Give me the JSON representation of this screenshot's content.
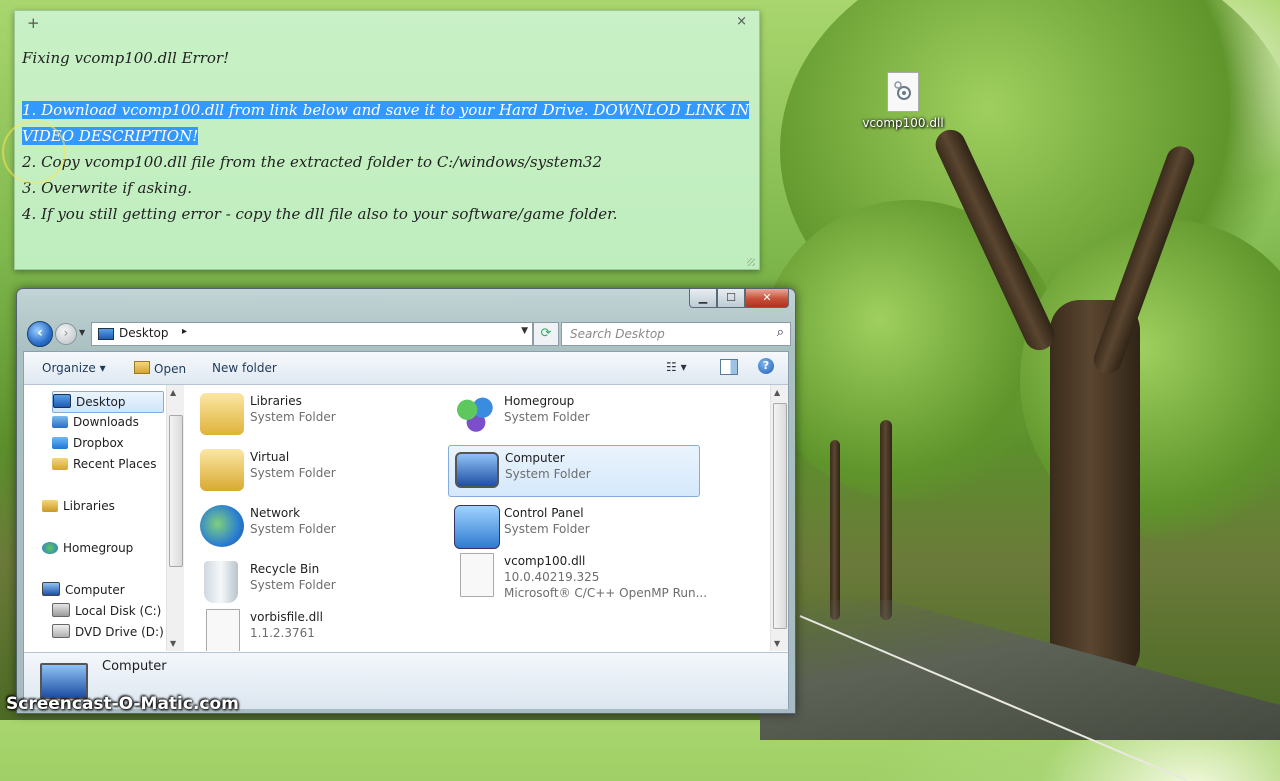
{
  "sticky_note": {
    "title": "Fixing vcomp100.dll Error!",
    "step1_selected": "1. Download vcomp100.dll from link below and save it to your Hard Drive. DOWNLOD LINK IN VIDEO DESCRIPTION!",
    "step2": "2. Copy vcomp100.dll file from the extracted folder to C:/windows/system32",
    "step3": "3. Overwrite if asking.",
    "step4": "4. If you still getting error - copy the dll file also to your software/game folder.",
    "new_note_glyph": "+",
    "close_glyph": "×"
  },
  "desktop": {
    "icon_label": "vcomp100.dll"
  },
  "explorer": {
    "address": {
      "location": "Desktop",
      "separator": "▸"
    },
    "search": {
      "placeholder": "Search Desktop"
    },
    "toolbar": {
      "organize": "Organize ▾",
      "open": "Open",
      "new_folder": "New folder"
    },
    "nav": [
      {
        "label": "Desktop",
        "icon": "desktop-icon",
        "selected": true
      },
      {
        "label": "Downloads",
        "icon": "downloads-icon"
      },
      {
        "label": "Dropbox",
        "icon": "dropbox-icon"
      },
      {
        "label": "Recent Places",
        "icon": "recent-places-icon"
      },
      {
        "label": "Libraries",
        "icon": "libraries-icon"
      },
      {
        "label": "Homegroup",
        "icon": "homegroup-icon"
      },
      {
        "label": "Computer",
        "icon": "computer-icon"
      },
      {
        "label": "Local Disk (C:)",
        "icon": "local-disk-icon"
      },
      {
        "label": "DVD Drive (D:) GF",
        "icon": "dvd-drive-icon"
      }
    ],
    "items": [
      {
        "name": "Libraries",
        "type": "System Folder",
        "icon": "libraries-icon"
      },
      {
        "name": "Homegroup",
        "type": "System Folder",
        "icon": "homegroup-icon"
      },
      {
        "name": "Virtual",
        "type": "System Folder",
        "icon": "user-folder-icon"
      },
      {
        "name": "Computer",
        "type": "System Folder",
        "icon": "computer-icon",
        "selected": true
      },
      {
        "name": "Network",
        "type": "System Folder",
        "icon": "network-icon"
      },
      {
        "name": "Control Panel",
        "type": "System Folder",
        "icon": "control-panel-icon"
      },
      {
        "name": "Recycle Bin",
        "type": "System Folder",
        "icon": "recycle-bin-icon"
      },
      {
        "name": "vcomp100.dll",
        "type": "10.0.40219.325",
        "description": "Microsoft® C/C++ OpenMP Run...",
        "icon": "dll-file-icon"
      },
      {
        "name": "vorbisfile.dll",
        "type": "1.1.2.3761",
        "icon": "dll-file-icon"
      }
    ],
    "details_pane": {
      "name": "Computer"
    }
  },
  "watermark": "Screencast-O-Matic.com"
}
